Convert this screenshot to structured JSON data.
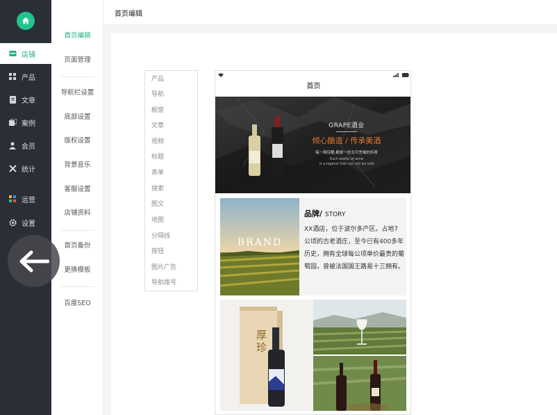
{
  "sidebar": {
    "items": [
      {
        "label": "店铺",
        "icon": "store-icon"
      },
      {
        "label": "产品",
        "icon": "grid-icon"
      },
      {
        "label": "文章",
        "icon": "document-icon"
      },
      {
        "label": "案例",
        "icon": "case-icon"
      },
      {
        "label": "会员",
        "icon": "member-icon"
      },
      {
        "label": "统计",
        "icon": "stats-icon"
      },
      {
        "label": "运营",
        "icon": "apps-icon"
      },
      {
        "label": "设置",
        "icon": "gear-icon"
      }
    ]
  },
  "subnav": {
    "items": [
      "首页编辑",
      "页面管理",
      "导航栏设置",
      "底部设置",
      "版权设置",
      "背景音乐",
      "客服设置",
      "店铺资料",
      "首页备份",
      "更换模板",
      "百度SEO"
    ]
  },
  "header": {
    "title": "首页编辑"
  },
  "components": [
    "产品",
    "导航",
    "橱窗",
    "文章",
    "视频",
    "标题",
    "表单",
    "搜索",
    "图文",
    "地图",
    "分隔线",
    "按钮",
    "图片广告",
    "导航拨号"
  ],
  "phone": {
    "title": "首页",
    "banner": {
      "brand": "GRAPE酒业",
      "slogan": "倾心酿造 / 传承美酒",
      "sub": "每一瓶佳酿,都是一份无可言喻的传奇",
      "en1": "Each bottle of wine",
      "en2": "is a legend that can not be told"
    },
    "story": {
      "title": "品牌/",
      "title_en": "STORY",
      "brand_overlay": "BRAND",
      "body": "XX酒店，位于波尔多产区。占地7公顷的古老酒庄，至今已有400多年历史，拥有全球每公顷单价最贵的葡萄园，曾被法国国王路易十三拥有。"
    },
    "box_text": "厚珍"
  },
  "colors": {
    "accent": "#22b07d",
    "sidebar_bg": "#2a2f37"
  }
}
